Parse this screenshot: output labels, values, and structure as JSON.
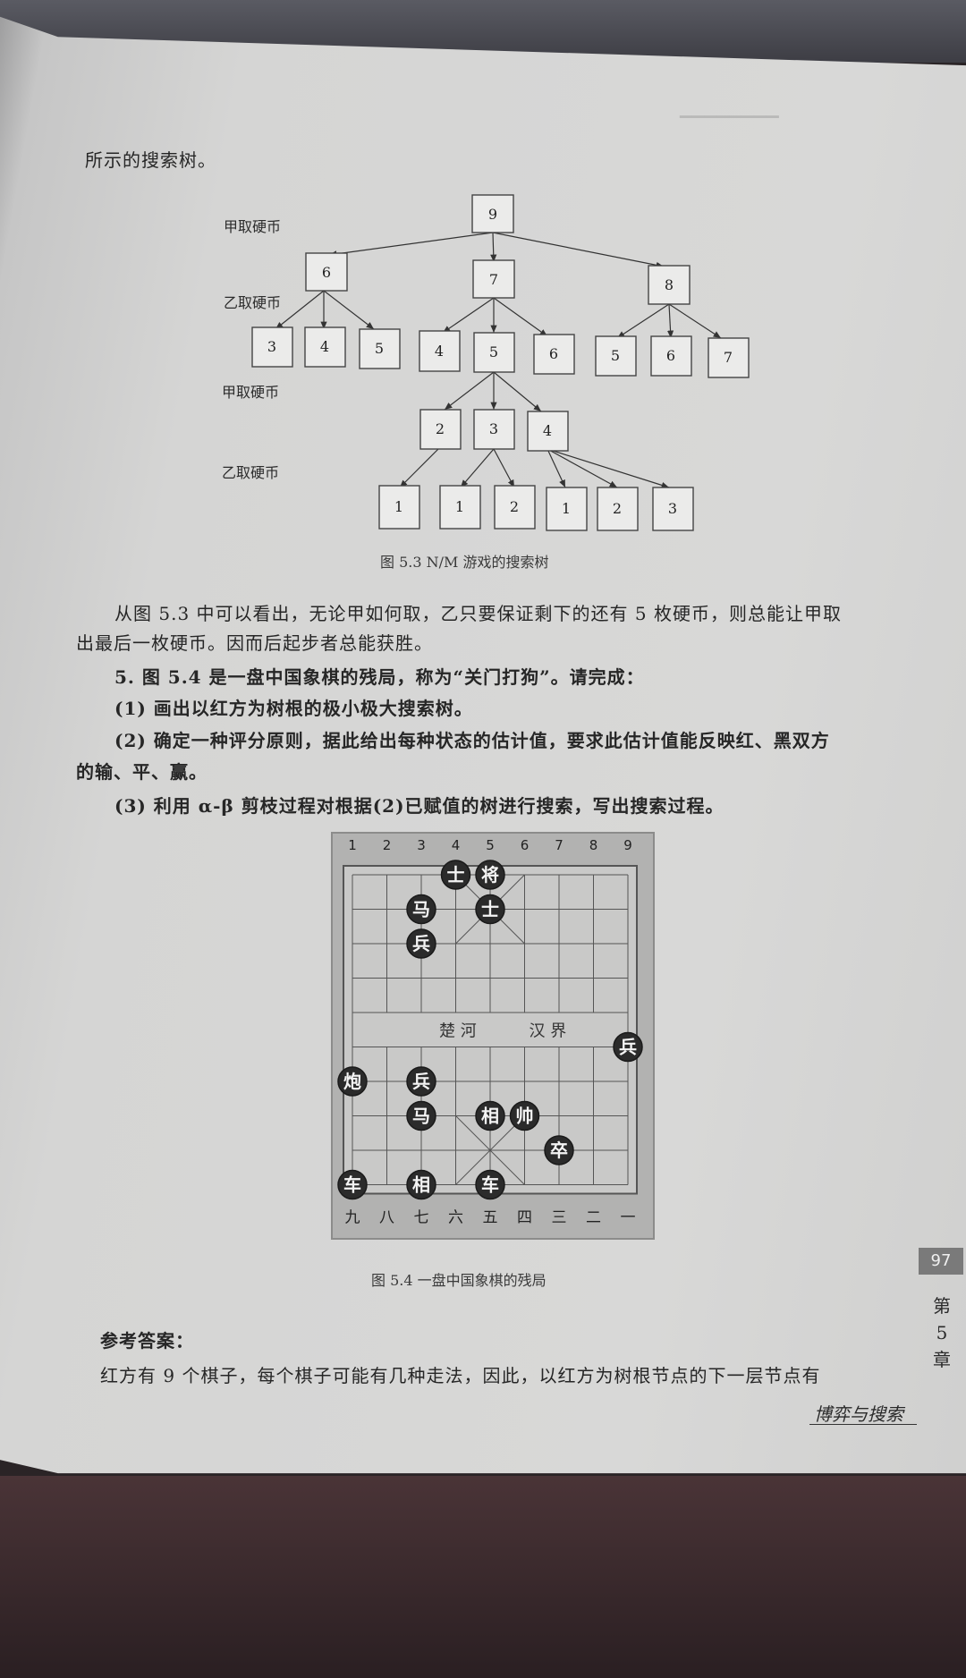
{
  "intro_line": "所示的搜索树。",
  "tree": {
    "level_labels": [
      "甲取硬币",
      "乙取硬币",
      "甲取硬币",
      "乙取硬币"
    ],
    "root": "9",
    "level1": [
      "6",
      "7",
      "8"
    ],
    "level2_left": [
      "3",
      "4",
      "5"
    ],
    "level2_mid": [
      "4",
      "5",
      "6"
    ],
    "level2_right": [
      "5",
      "6",
      "7"
    ],
    "level3": [
      "2",
      "3",
      "4"
    ],
    "level4": [
      "1",
      "1",
      "2",
      "1",
      "2",
      "3"
    ],
    "caption": "图 5.3 N/M 游戏的搜索树"
  },
  "paragraph1": [
    "从图 5.3 中可以看出，无论甲如何取，乙只要保证剩下的还有 5 枚硬币，则总能让甲取",
    "出最后一枚硬币。因而后起步者总能获胜。"
  ],
  "question": {
    "title": "5. 图 5.4 是一盘中国象棋的残局，称为“关门打狗”。请完成：",
    "item1": "(1) 画出以红方为树根的极小极大搜索树。",
    "item2a": "(2) 确定一种评分原则，据此给出每种状态的估计值，要求此估计值能反映红、黑双方",
    "item2b": "的输、平、赢。",
    "item3": "(3) 利用 α-β 剪枝过程对根据(2)已赋值的树进行搜索，写出搜索过程。"
  },
  "board": {
    "top_numbers": [
      "1",
      "2",
      "3",
      "4",
      "5",
      "6",
      "7",
      "8",
      "9"
    ],
    "bottom_numbers": [
      "九",
      "八",
      "七",
      "六",
      "五",
      "四",
      "三",
      "二",
      "一"
    ],
    "river_left": "楚 河",
    "river_right": "汉 界",
    "caption": "图 5.4 一盘中国象棋的残局"
  },
  "pieces": [
    {
      "label": "士",
      "file": 4,
      "rank": 0,
      "color": "dark"
    },
    {
      "label": "将",
      "file": 5,
      "rank": 0,
      "color": "dark"
    },
    {
      "label": "马",
      "file": 3,
      "rank": 1,
      "color": "dark"
    },
    {
      "label": "士",
      "file": 5,
      "rank": 1,
      "color": "dark"
    },
    {
      "label": "兵",
      "file": 3,
      "rank": 2,
      "color": "dark"
    },
    {
      "label": "兵",
      "file": 9,
      "rank": 5,
      "color": "dark"
    },
    {
      "label": "炮",
      "file": 1,
      "rank": 6,
      "color": "dark"
    },
    {
      "label": "兵",
      "file": 3,
      "rank": 6,
      "color": "dark"
    },
    {
      "label": "马",
      "file": 3,
      "rank": 7,
      "color": "dark"
    },
    {
      "label": "相",
      "file": 5,
      "rank": 7,
      "color": "dark"
    },
    {
      "label": "帅",
      "file": 6,
      "rank": 7,
      "color": "dark"
    },
    {
      "label": "卒",
      "file": 7,
      "rank": 8,
      "color": "dark"
    },
    {
      "label": "车",
      "file": 1,
      "rank": 9,
      "color": "dark"
    },
    {
      "label": "相",
      "file": 3,
      "rank": 9,
      "color": "dark"
    },
    {
      "label": "车",
      "file": 5,
      "rank": 9,
      "color": "dark"
    }
  ],
  "answer": {
    "title": "参考答案：",
    "text": "红方有 9 个棋子，每个棋子可能有几种走法，因此，以红方为树根节点的下一层节点有"
  },
  "side": {
    "page_number": "97",
    "chapter": [
      "第",
      "5",
      "章"
    ],
    "footer": "博弈与搜索"
  }
}
